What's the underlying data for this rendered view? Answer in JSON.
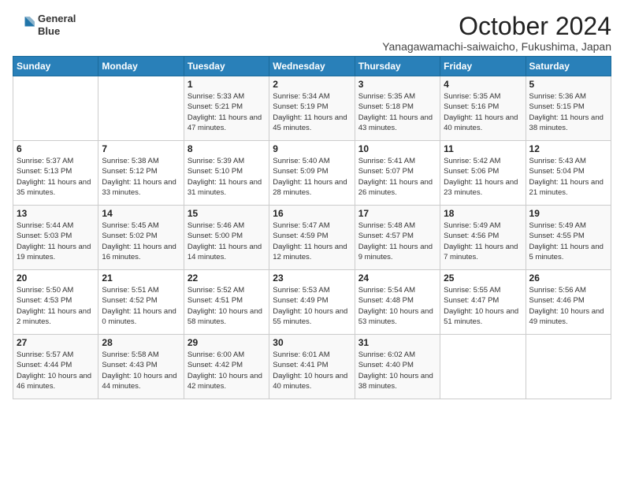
{
  "header": {
    "logo_line1": "General",
    "logo_line2": "Blue",
    "month": "October 2024",
    "location": "Yanagawamachi-saiwaicho, Fukushima, Japan"
  },
  "days_of_week": [
    "Sunday",
    "Monday",
    "Tuesday",
    "Wednesday",
    "Thursday",
    "Friday",
    "Saturday"
  ],
  "weeks": [
    [
      {
        "day": "",
        "info": ""
      },
      {
        "day": "",
        "info": ""
      },
      {
        "day": "1",
        "info": "Sunrise: 5:33 AM\nSunset: 5:21 PM\nDaylight: 11 hours and 47 minutes."
      },
      {
        "day": "2",
        "info": "Sunrise: 5:34 AM\nSunset: 5:19 PM\nDaylight: 11 hours and 45 minutes."
      },
      {
        "day": "3",
        "info": "Sunrise: 5:35 AM\nSunset: 5:18 PM\nDaylight: 11 hours and 43 minutes."
      },
      {
        "day": "4",
        "info": "Sunrise: 5:35 AM\nSunset: 5:16 PM\nDaylight: 11 hours and 40 minutes."
      },
      {
        "day": "5",
        "info": "Sunrise: 5:36 AM\nSunset: 5:15 PM\nDaylight: 11 hours and 38 minutes."
      }
    ],
    [
      {
        "day": "6",
        "info": "Sunrise: 5:37 AM\nSunset: 5:13 PM\nDaylight: 11 hours and 35 minutes."
      },
      {
        "day": "7",
        "info": "Sunrise: 5:38 AM\nSunset: 5:12 PM\nDaylight: 11 hours and 33 minutes."
      },
      {
        "day": "8",
        "info": "Sunrise: 5:39 AM\nSunset: 5:10 PM\nDaylight: 11 hours and 31 minutes."
      },
      {
        "day": "9",
        "info": "Sunrise: 5:40 AM\nSunset: 5:09 PM\nDaylight: 11 hours and 28 minutes."
      },
      {
        "day": "10",
        "info": "Sunrise: 5:41 AM\nSunset: 5:07 PM\nDaylight: 11 hours and 26 minutes."
      },
      {
        "day": "11",
        "info": "Sunrise: 5:42 AM\nSunset: 5:06 PM\nDaylight: 11 hours and 23 minutes."
      },
      {
        "day": "12",
        "info": "Sunrise: 5:43 AM\nSunset: 5:04 PM\nDaylight: 11 hours and 21 minutes."
      }
    ],
    [
      {
        "day": "13",
        "info": "Sunrise: 5:44 AM\nSunset: 5:03 PM\nDaylight: 11 hours and 19 minutes."
      },
      {
        "day": "14",
        "info": "Sunrise: 5:45 AM\nSunset: 5:02 PM\nDaylight: 11 hours and 16 minutes."
      },
      {
        "day": "15",
        "info": "Sunrise: 5:46 AM\nSunset: 5:00 PM\nDaylight: 11 hours and 14 minutes."
      },
      {
        "day": "16",
        "info": "Sunrise: 5:47 AM\nSunset: 4:59 PM\nDaylight: 11 hours and 12 minutes."
      },
      {
        "day": "17",
        "info": "Sunrise: 5:48 AM\nSunset: 4:57 PM\nDaylight: 11 hours and 9 minutes."
      },
      {
        "day": "18",
        "info": "Sunrise: 5:49 AM\nSunset: 4:56 PM\nDaylight: 11 hours and 7 minutes."
      },
      {
        "day": "19",
        "info": "Sunrise: 5:49 AM\nSunset: 4:55 PM\nDaylight: 11 hours and 5 minutes."
      }
    ],
    [
      {
        "day": "20",
        "info": "Sunrise: 5:50 AM\nSunset: 4:53 PM\nDaylight: 11 hours and 2 minutes."
      },
      {
        "day": "21",
        "info": "Sunrise: 5:51 AM\nSunset: 4:52 PM\nDaylight: 11 hours and 0 minutes."
      },
      {
        "day": "22",
        "info": "Sunrise: 5:52 AM\nSunset: 4:51 PM\nDaylight: 10 hours and 58 minutes."
      },
      {
        "day": "23",
        "info": "Sunrise: 5:53 AM\nSunset: 4:49 PM\nDaylight: 10 hours and 55 minutes."
      },
      {
        "day": "24",
        "info": "Sunrise: 5:54 AM\nSunset: 4:48 PM\nDaylight: 10 hours and 53 minutes."
      },
      {
        "day": "25",
        "info": "Sunrise: 5:55 AM\nSunset: 4:47 PM\nDaylight: 10 hours and 51 minutes."
      },
      {
        "day": "26",
        "info": "Sunrise: 5:56 AM\nSunset: 4:46 PM\nDaylight: 10 hours and 49 minutes."
      }
    ],
    [
      {
        "day": "27",
        "info": "Sunrise: 5:57 AM\nSunset: 4:44 PM\nDaylight: 10 hours and 46 minutes."
      },
      {
        "day": "28",
        "info": "Sunrise: 5:58 AM\nSunset: 4:43 PM\nDaylight: 10 hours and 44 minutes."
      },
      {
        "day": "29",
        "info": "Sunrise: 6:00 AM\nSunset: 4:42 PM\nDaylight: 10 hours and 42 minutes."
      },
      {
        "day": "30",
        "info": "Sunrise: 6:01 AM\nSunset: 4:41 PM\nDaylight: 10 hours and 40 minutes."
      },
      {
        "day": "31",
        "info": "Sunrise: 6:02 AM\nSunset: 4:40 PM\nDaylight: 10 hours and 38 minutes."
      },
      {
        "day": "",
        "info": ""
      },
      {
        "day": "",
        "info": ""
      }
    ]
  ]
}
